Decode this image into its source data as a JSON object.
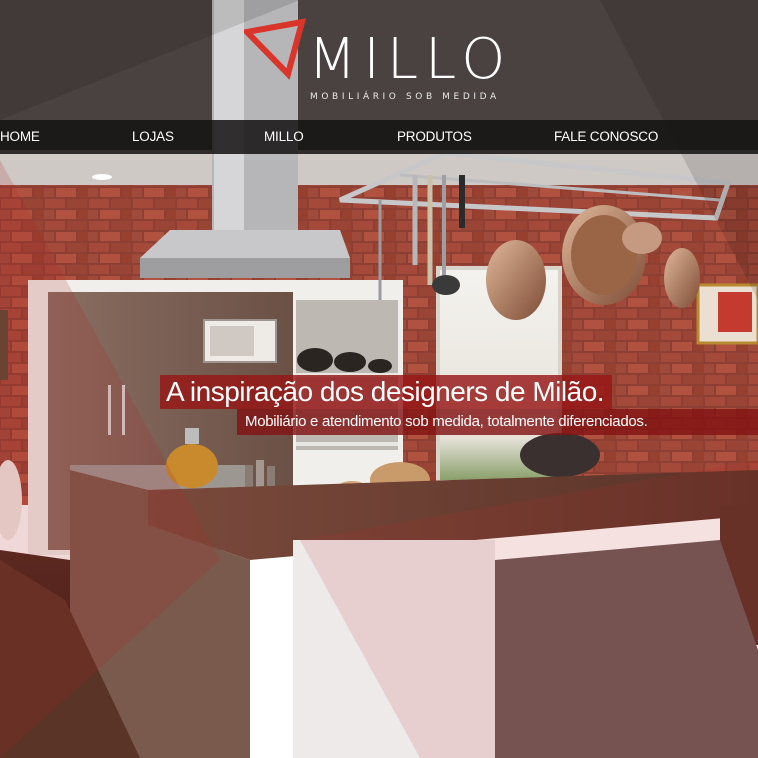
{
  "brand": {
    "name": "MILLO",
    "tagline": "MOBILIÁRIO SOB MEDIDA",
    "accent_color": "#d9352a"
  },
  "nav": {
    "items": [
      {
        "label": "HOME"
      },
      {
        "label": "LOJAS"
      },
      {
        "label": "MILLO"
      },
      {
        "label": "PRODUTOS"
      },
      {
        "label": "FALE CONOSCO"
      }
    ]
  },
  "hero": {
    "headline": "A inspiração dos designers de Milão.",
    "subline": "Mobiliário e atendimento sob medida, totalmente diferenciados.",
    "scene": "kitchen-photo"
  }
}
